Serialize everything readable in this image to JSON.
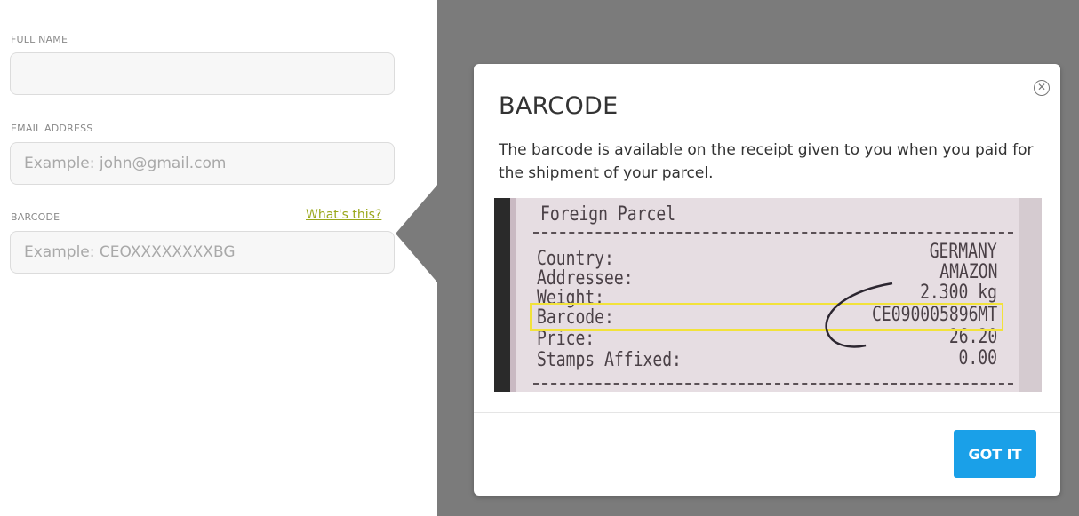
{
  "form": {
    "full_name": {
      "label": "FULL NAME",
      "value": "",
      "placeholder": ""
    },
    "email": {
      "label": "EMAIL ADDRESS",
      "value": "",
      "placeholder": "Example: john@gmail.com"
    },
    "barcode": {
      "label": "BARCODE",
      "value": "",
      "placeholder": "Example: CEOXXXXXXXXBG",
      "help_link": "What's this?"
    }
  },
  "modal": {
    "title": "BARCODE",
    "description": "The barcode is available on the receipt given to you when you paid for the shipment of your parcel.",
    "close_icon": "close-circle-icon",
    "button_label": "GOT IT",
    "button_color": "#1aa0e8",
    "receipt": {
      "header": "Foreign Parcel",
      "rows": [
        {
          "label": "Country:",
          "value": "GERMANY"
        },
        {
          "label": "Addressee:",
          "value": "AMAZON"
        },
        {
          "label": "Weight:",
          "value": "2.300 kg"
        },
        {
          "label": "Barcode:",
          "value": "CE090005896MT"
        },
        {
          "label": "Price:",
          "value": "26.20"
        },
        {
          "label": "Stamps Affixed:",
          "value": "0.00"
        }
      ],
      "highlight_color": "#f2e23a"
    }
  },
  "colors": {
    "overlay": "#7b7b7b",
    "link": "#9aa81b"
  }
}
